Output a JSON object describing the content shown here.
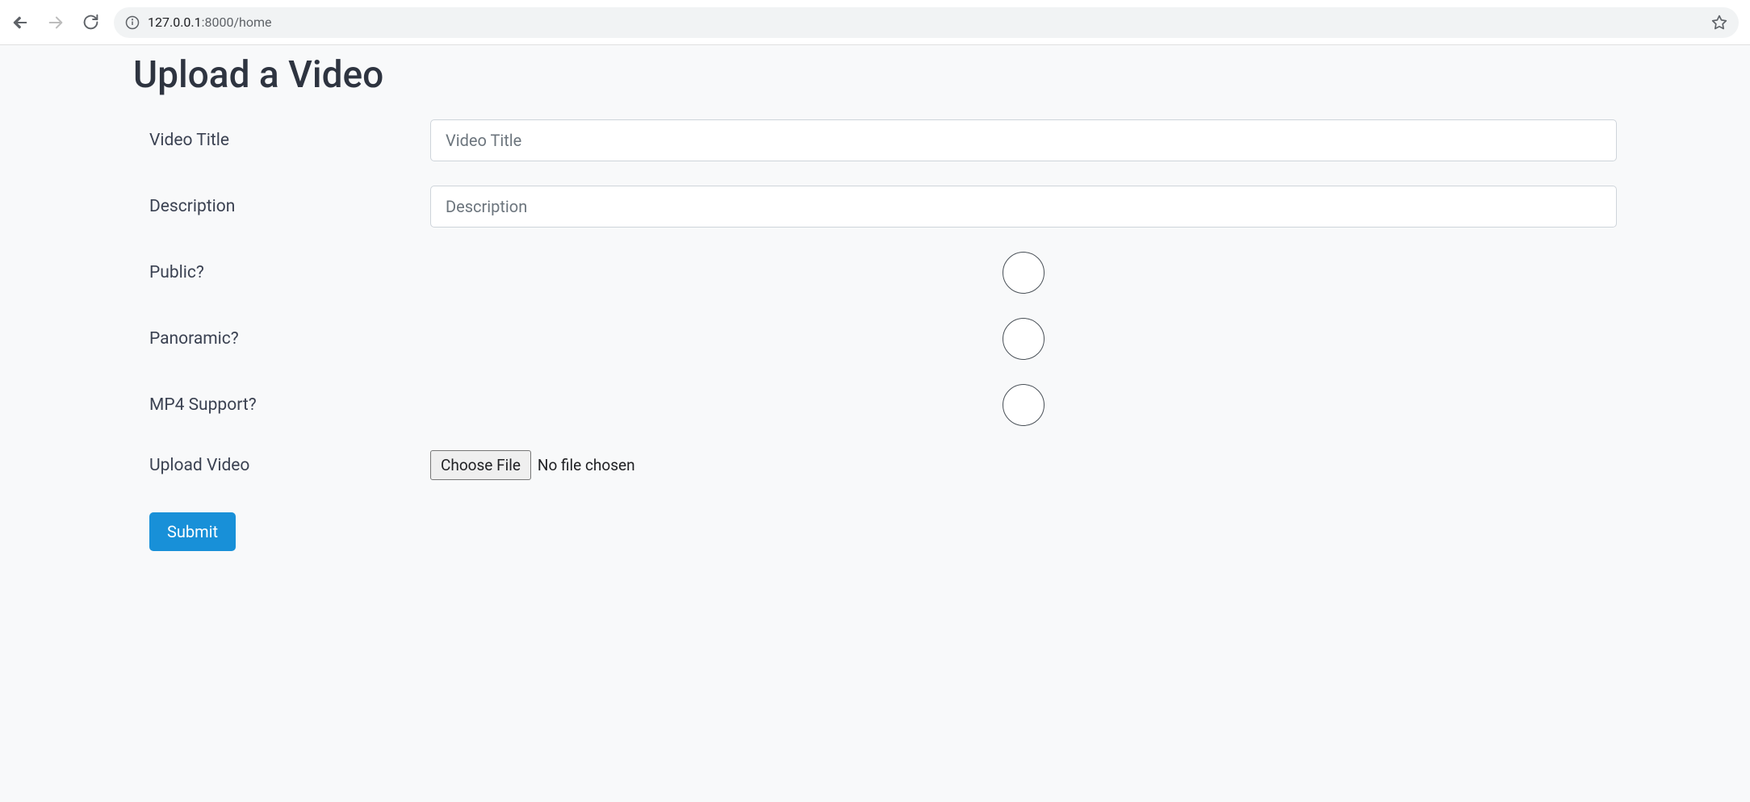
{
  "browser": {
    "url_host": "127.0.0.1",
    "url_port_path": ":8000/home"
  },
  "page": {
    "title": "Upload a Video"
  },
  "form": {
    "video_title": {
      "label": "Video Title",
      "placeholder": "Video Title",
      "value": ""
    },
    "description": {
      "label": "Description",
      "placeholder": "Description",
      "value": ""
    },
    "public": {
      "label": "Public?",
      "checked": false
    },
    "panoramic": {
      "label": "Panoramic?",
      "checked": false
    },
    "mp4_support": {
      "label": "MP4 Support?",
      "checked": false
    },
    "upload_video": {
      "label": "Upload Video",
      "button_label": "Choose File",
      "status": "No file chosen"
    },
    "submit_label": "Submit"
  }
}
